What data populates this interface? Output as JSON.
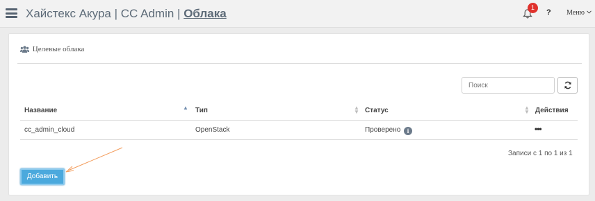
{
  "header": {
    "app_name": "Хайстекс Акура",
    "separator": "|",
    "section": "CC Admin",
    "page": "Облака",
    "notification_count": "1",
    "help_label": "?",
    "menu_label": "Меню",
    "menu_icon": "chevron-down-icon"
  },
  "panel": {
    "title": "Целевые облака",
    "title_icon": "users-icon"
  },
  "search": {
    "placeholder": "Поиск",
    "value": ""
  },
  "table": {
    "columns": [
      "Название",
      "Тип",
      "Статус",
      "Действия"
    ],
    "sorted_column": "Название",
    "rows": [
      {
        "name": "cc_admin_cloud",
        "type": "OpenStack",
        "status": "Проверено",
        "actions": "•••"
      }
    ],
    "records_summary": "Записи с 1 по 1 из 1"
  },
  "buttons": {
    "add_label": "Добавить"
  },
  "colors": {
    "accent": "#4ba9dd",
    "badge": "#e0322d",
    "annotation_arrow": "#f39c5b"
  }
}
